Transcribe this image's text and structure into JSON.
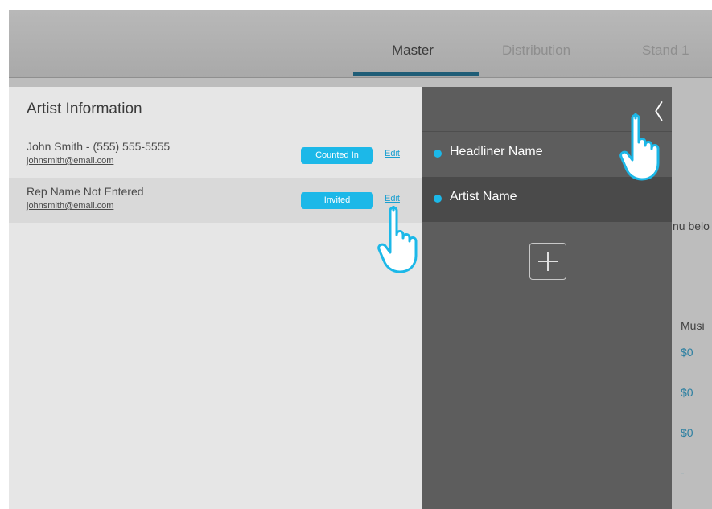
{
  "tabs": [
    {
      "label": "Master",
      "active": true
    },
    {
      "label": "Distribution",
      "active": false
    },
    {
      "label": "Stand 1",
      "active": false
    }
  ],
  "background": {
    "partial_text": "nu belo",
    "column_header": "Musi",
    "amounts": [
      "$0",
      "$0",
      "$0",
      "-"
    ]
  },
  "artist_panel": {
    "title": "Artist Information",
    "rows": [
      {
        "name": "John Smith - (555) 555-5555",
        "email": "johnsmith@email.com",
        "status": "Counted In",
        "edit_label": "Edit"
      },
      {
        "name": "Rep Name Not Entered",
        "email": "johnsmith@email.com",
        "status": "Invited",
        "edit_label": "Edit"
      }
    ]
  },
  "side_panel": {
    "collapse_icon": "chevron-left-icon",
    "items": [
      {
        "label": "Headliner Name",
        "selected": false
      },
      {
        "label": "Artist Name",
        "selected": true
      }
    ],
    "add_icon": "plus-icon"
  },
  "colors": {
    "accent": "#1cb8e8",
    "tab_underline": "#1f5d77",
    "dark_panel": "#5d5d5d",
    "money": "#2a7fa1"
  }
}
